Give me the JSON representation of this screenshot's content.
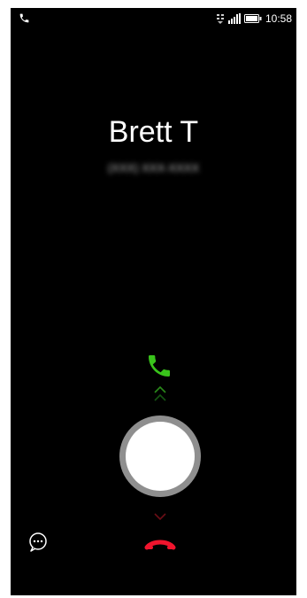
{
  "status_bar": {
    "time": "10:58",
    "left_icon": "phone-call-icon",
    "network_icon": "3g-network-icon",
    "signal_icon": "signal-strength-icon",
    "battery_icon": "battery-icon"
  },
  "caller": {
    "name": "Brett T",
    "number": "(XXX) XXX-XXXX"
  },
  "actions": {
    "answer_icon": "answer-call-icon",
    "decline_icon": "decline-call-icon",
    "message_icon": "message-icon",
    "slider_icon": "slide-handle"
  },
  "colors": {
    "background": "#000000",
    "answer": "#39c31b",
    "decline": "#f0142d",
    "handle": "#ffffff",
    "handle_ring": "#8f8f8f"
  }
}
